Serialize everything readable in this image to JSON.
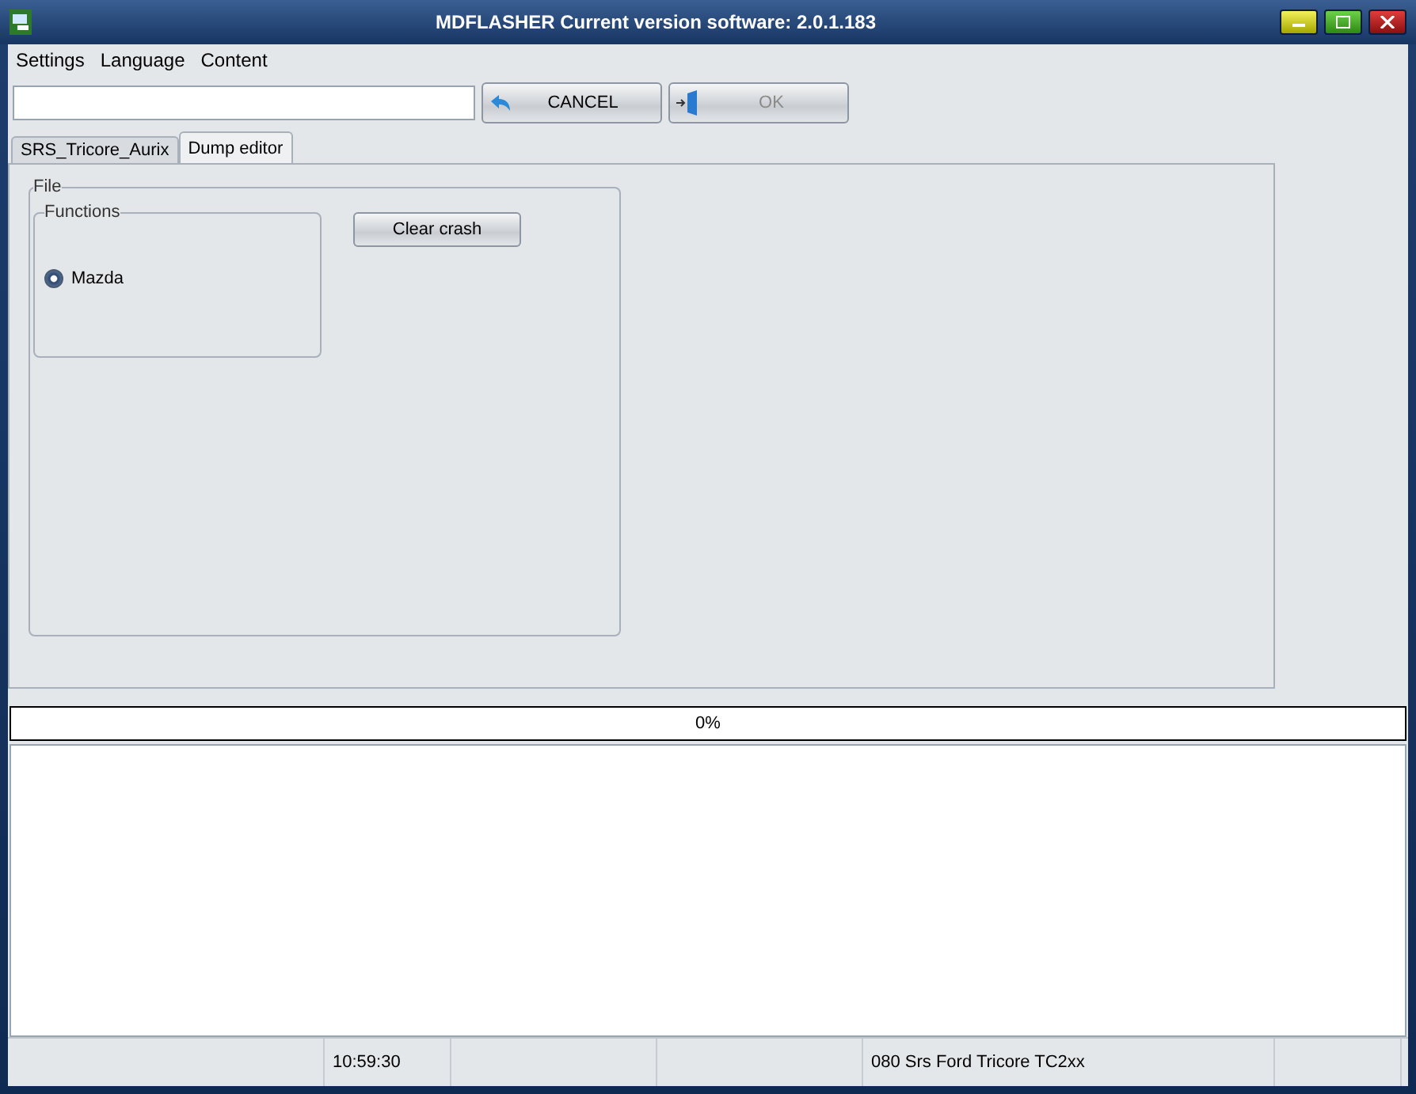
{
  "window": {
    "title": "MDFLASHER  Current version software: 2.0.1.183"
  },
  "menu": [
    "Settings",
    "Language",
    "Content"
  ],
  "toolbar": {
    "buttons": [
      {
        "label": "CANCEL",
        "kind": "cancel",
        "disabled": false
      },
      {
        "label": "OK",
        "kind": "ok",
        "disabled": true
      }
    ]
  },
  "tabs": [
    {
      "label": "SRS_Tricore_Aurix",
      "selected": false
    },
    {
      "label": "Dump editor",
      "selected": true
    }
  ],
  "file_group": {
    "title": "File",
    "functions": {
      "title": "Functions",
      "options": [
        {
          "label": "Mazda",
          "selected": true
        }
      ]
    },
    "button": "Clear crash"
  },
  "progress": {
    "level": 0,
    "text": "0%"
  },
  "status_bar": {
    "time": "10:59:30",
    "module": "080 Srs Ford Tricore TC2xx"
  }
}
